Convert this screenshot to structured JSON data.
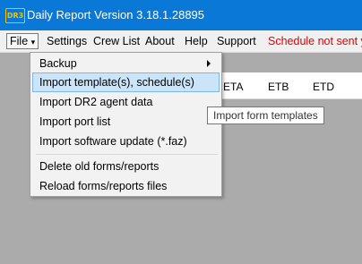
{
  "window": {
    "title": "Daily Report Version 3.18.1.28895",
    "logo_text": "DR3"
  },
  "menubar": {
    "file": "File",
    "file_arrow": "▾",
    "settings": "Settings",
    "crew_list": "Crew List",
    "about": "About",
    "help": "Help",
    "support": "Support",
    "status": "Schedule not sent ye"
  },
  "grid": {
    "columns": [
      "ETA",
      "ETB",
      "ETD"
    ]
  },
  "file_menu": {
    "backup": "Backup",
    "import_templates": "Import template(s), schedule(s)",
    "import_dr2": "Import DR2 agent data",
    "import_port": "Import port list",
    "import_update": "Import software update (*.faz)",
    "delete_old": "Delete old forms/reports",
    "reload": "Reload forms/reports files"
  },
  "tooltip": "Import form templates"
}
